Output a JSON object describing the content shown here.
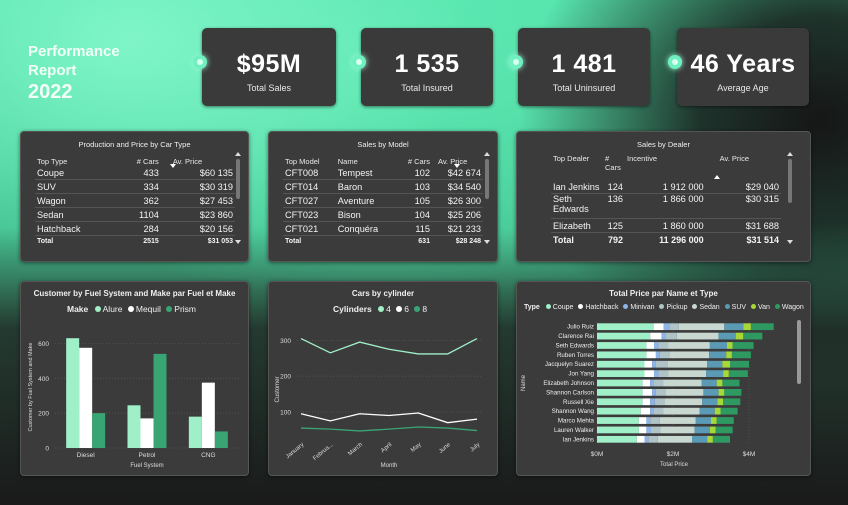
{
  "title": {
    "line1": "Performance",
    "line2": "Report",
    "line3": "2022"
  },
  "kpis": [
    {
      "value": "$95M",
      "label": "Total Sales"
    },
    {
      "value": "1 535",
      "label": "Total Insured"
    },
    {
      "value": "1 481",
      "label": "Total Uninsured"
    },
    {
      "value": "46 Years",
      "label": "Average Age"
    }
  ],
  "colors": {
    "accent": "#6ff0c0",
    "light_green": "#9ff0c8",
    "white": "#ffffff",
    "dark_green": "#3aa574",
    "panel": "#3b3b3b"
  },
  "table_car_type": {
    "title": "Production and Price by Car Type",
    "headers": [
      "Top Type",
      "# Cars",
      "Av. Price"
    ],
    "rows": [
      [
        "Coupe",
        "433",
        "$60 135"
      ],
      [
        "SUV",
        "334",
        "$30 319"
      ],
      [
        "Wagon",
        "362",
        "$27 453"
      ],
      [
        "Sedan",
        "1104",
        "$23 860"
      ],
      [
        "Hatchback",
        "284",
        "$20 156"
      ]
    ],
    "total": [
      "Total",
      "2515",
      "$31 053"
    ]
  },
  "table_model": {
    "title": "Sales by Model",
    "headers": [
      "Top Model",
      "Name",
      "# Cars",
      "Av. Price"
    ],
    "rows": [
      [
        "CFT008",
        "Tempest",
        "102",
        "$42 674"
      ],
      [
        "CFT014",
        "Baron",
        "103",
        "$34 540"
      ],
      [
        "CFT027",
        "Aventure",
        "105",
        "$26 300"
      ],
      [
        "CFT023",
        "Bison",
        "104",
        "$25 206"
      ],
      [
        "CFT021",
        "Conquéra",
        "115",
        "$21 233"
      ]
    ],
    "total": [
      "Total",
      "",
      "631",
      "$28 248"
    ]
  },
  "table_dealer": {
    "title": "Sales by Dealer",
    "headers": [
      "Top Dealer",
      "# Cars",
      "Incentive",
      "Av. Price"
    ],
    "rows": [
      [
        "Ian Jenkins",
        "124",
        "1 912 000",
        "$29 040"
      ],
      [
        "Seth Edwards",
        "136",
        "1 866 000",
        "$30 315"
      ],
      [
        "Elizabeth",
        "125",
        "1 860 000",
        "$31 688"
      ]
    ],
    "total": [
      "Total",
      "792",
      "11 296 000",
      "$31 514"
    ]
  },
  "chart_data": [
    {
      "type": "bar",
      "title": "Customer by Fuel System and Make par Fuel et Make",
      "legend_title": "Make",
      "xlabel": "Fuel System",
      "ylabel": "Customer by Fuel System and Make",
      "categories": [
        "Diesel",
        "Petrol",
        "CNG"
      ],
      "series": [
        {
          "name": "Alure",
          "color": "#9ff0c8",
          "values": [
            630,
            245,
            180
          ]
        },
        {
          "name": "Mequil",
          "color": "#ffffff",
          "values": [
            575,
            170,
            375
          ]
        },
        {
          "name": "Prism",
          "color": "#3aa574",
          "values": [
            200,
            540,
            95
          ]
        }
      ],
      "ylim": [
        0,
        700
      ],
      "yticks": [
        0,
        200,
        400,
        600
      ],
      "legend_position": "top"
    },
    {
      "type": "line",
      "title": "Cars by cylinder",
      "legend_title": "Cylinders",
      "xlabel": "Month",
      "ylabel": "Customer",
      "x": [
        "January",
        "February",
        "March",
        "April",
        "May",
        "June",
        "July"
      ],
      "x_tick_labels": [
        "January",
        "Februa...",
        "March",
        "April",
        "May",
        "June",
        "July"
      ],
      "series": [
        {
          "name": "4",
          "color": "#9ff0c8",
          "values": [
            305,
            265,
            295,
            275,
            262,
            262,
            305
          ]
        },
        {
          "name": "6",
          "color": "#ffffff",
          "values": [
            95,
            75,
            95,
            90,
            97,
            70,
            80
          ]
        },
        {
          "name": "8",
          "color": "#3aa574",
          "values": [
            55,
            52,
            47,
            52,
            58,
            55,
            48
          ]
        }
      ],
      "ylim": [
        30,
        340
      ],
      "yticks": [
        100,
        200,
        300
      ],
      "legend_position": "top"
    },
    {
      "type": "bar",
      "orientation": "horizontal",
      "stacked": true,
      "title": "Total Price par Name et Type",
      "legend_title": "Type",
      "xlabel": "Total Price",
      "ylabel": "Name",
      "categories": [
        "Julio Ruiz",
        "Clarence Rai",
        "Seth Edwards",
        "Ruben Torres",
        "Jacquelyn Suarez",
        "Jon Yang",
        "Elizabeth Johnson",
        "Shannon Carlson",
        "Russell Xie",
        "Shannon Wang",
        "Marco Mehta",
        "Lauren Walker",
        "Ian Jenkins"
      ],
      "series": [
        {
          "name": "Coupe",
          "color": "#9ff0c8",
          "values": [
            1.5,
            1.4,
            1.3,
            1.3,
            1.25,
            1.25,
            1.2,
            1.2,
            1.2,
            1.15,
            1.1,
            1.1,
            1.05
          ]
        },
        {
          "name": "Hatchback",
          "color": "#ffffff",
          "values": [
            0.25,
            0.3,
            0.2,
            0.25,
            0.2,
            0.25,
            0.2,
            0.25,
            0.2,
            0.25,
            0.2,
            0.2,
            0.2
          ]
        },
        {
          "name": "Minivan",
          "color": "#8fb5e8",
          "values": [
            0.15,
            0.1,
            0.12,
            0.1,
            0.1,
            0.12,
            0.1,
            0.1,
            0.12,
            0.1,
            0.1,
            0.12,
            0.1
          ]
        },
        {
          "name": "Pickup",
          "color": "#b0c4c8",
          "values": [
            0.25,
            0.3,
            0.25,
            0.25,
            0.3,
            0.25,
            0.25,
            0.25,
            0.25,
            0.25,
            0.25,
            0.25,
            0.25
          ]
        },
        {
          "name": "Sedan",
          "color": "#c8d8d0",
          "values": [
            1.2,
            1.1,
            1.1,
            1.05,
            1.05,
            1.0,
            1.0,
            1.0,
            1.0,
            0.95,
            0.95,
            0.9,
            0.9
          ]
        },
        {
          "name": "SUV",
          "color": "#5a9ab5",
          "values": [
            0.5,
            0.45,
            0.45,
            0.45,
            0.4,
            0.45,
            0.4,
            0.4,
            0.4,
            0.4,
            0.4,
            0.4,
            0.4
          ]
        },
        {
          "name": "Van",
          "color": "#a8d838",
          "values": [
            0.2,
            0.2,
            0.15,
            0.15,
            0.2,
            0.15,
            0.15,
            0.15,
            0.15,
            0.15,
            0.15,
            0.15,
            0.15
          ]
        },
        {
          "name": "Wagon",
          "color": "#2e9a62",
          "values": [
            0.6,
            0.5,
            0.55,
            0.5,
            0.5,
            0.5,
            0.45,
            0.45,
            0.45,
            0.45,
            0.45,
            0.45,
            0.45
          ]
        }
      ],
      "xlim": [
        0,
        5
      ],
      "xticks": [
        0,
        2,
        4
      ],
      "x_tick_labels": [
        "$0M",
        "$2M",
        "$4M"
      ],
      "legend_position": "top"
    }
  ]
}
